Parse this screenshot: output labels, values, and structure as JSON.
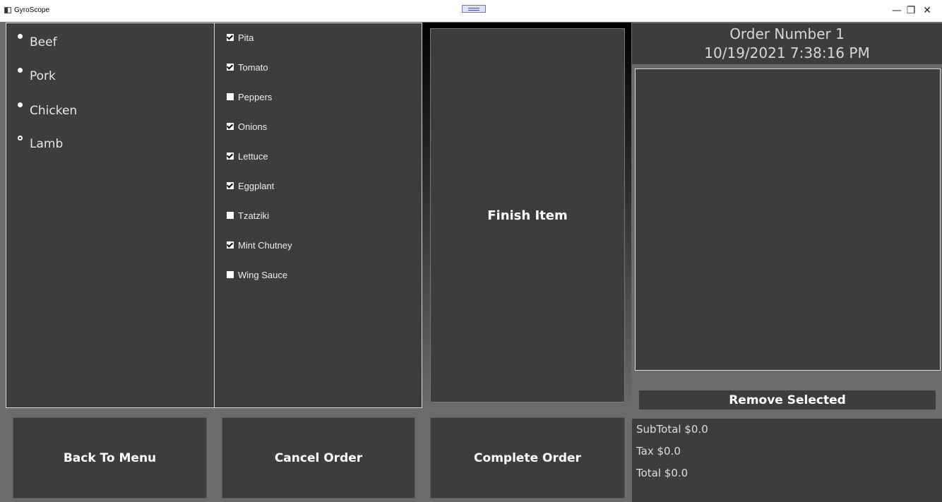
{
  "window": {
    "title": "GyroScope",
    "controls": {
      "minimize": "—",
      "restore": "❐",
      "close": "✕"
    }
  },
  "meats": {
    "items": [
      {
        "label": "Beef",
        "selected": false
      },
      {
        "label": "Pork",
        "selected": false
      },
      {
        "label": "Chicken",
        "selected": false
      },
      {
        "label": "Lamb",
        "selected": true
      }
    ]
  },
  "toppings": {
    "items": [
      {
        "label": "Pita",
        "checked": true
      },
      {
        "label": "Tomato",
        "checked": true
      },
      {
        "label": "Peppers",
        "checked": false
      },
      {
        "label": "Onions",
        "checked": true
      },
      {
        "label": "Lettuce",
        "checked": true
      },
      {
        "label": "Eggplant",
        "checked": true
      },
      {
        "label": "Tzatziki",
        "checked": false
      },
      {
        "label": "Mint Chutney",
        "checked": true
      },
      {
        "label": "Wing Sauce",
        "checked": false
      }
    ]
  },
  "actions": {
    "finish_item": "Finish Item",
    "back_to_menu": "Back To Menu",
    "cancel_order": "Cancel Order",
    "complete_order": "Complete Order",
    "remove_selected": "Remove Selected"
  },
  "order": {
    "number_label": "Order Number 1",
    "datetime": "10/19/2021 7:38:16 PM"
  },
  "totals": {
    "subtotal": "SubTotal $0.0",
    "tax": "Tax $0.0",
    "total": "Total $0.0"
  }
}
